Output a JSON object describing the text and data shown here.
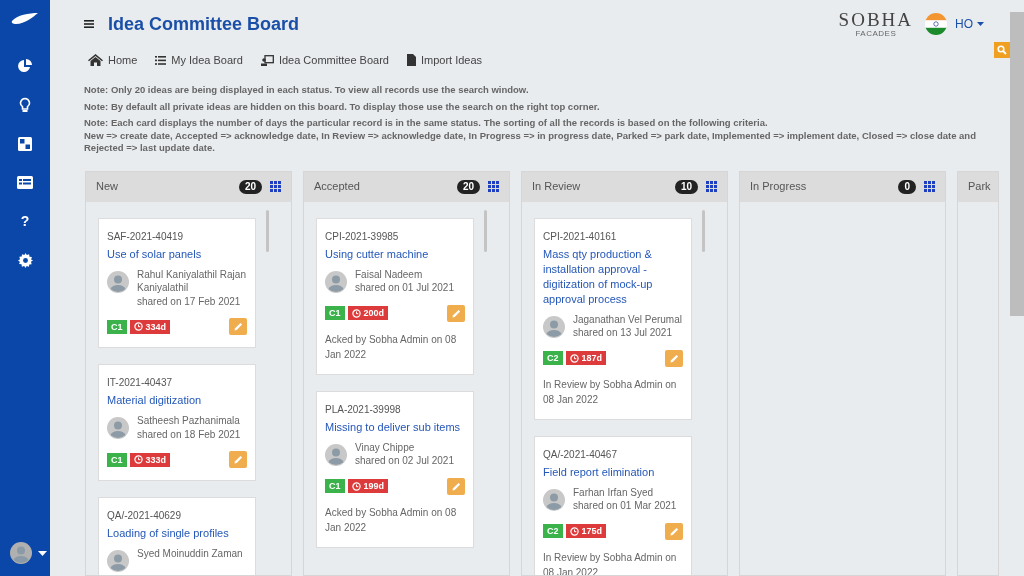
{
  "header": {
    "title": "Idea Committee Board",
    "brand": "SOBHA",
    "brand_sub": "FACADES",
    "user_location": "HO"
  },
  "nav": [
    {
      "label": "Home",
      "kind": "home"
    },
    {
      "label": "My Idea Board",
      "kind": "list"
    },
    {
      "label": "Idea Committee Board",
      "kind": "board"
    },
    {
      "label": "Import Ideas",
      "kind": "file"
    }
  ],
  "sidebar": {
    "items": [
      {
        "kind": "chart"
      },
      {
        "kind": "bulb"
      },
      {
        "kind": "grid"
      },
      {
        "kind": "table"
      },
      {
        "kind": "help",
        "label": "?"
      },
      {
        "kind": "settings"
      }
    ]
  },
  "notes": [
    "Note: Only 20 ideas are being displayed in each status. To view all records use the search window.",
    "Note: By default all private ideas are hidden on this board. To display those use the search on the right top corner.",
    "Note: Each card displays the number of days the particular record is in the same status. The sorting of all the records is based on the following criteria.\nNew => create date, Accepted => acknowledge date, In Review => acknowledge date, In Progress => in progress date, Parked => park date, Implemented => implement date, Closed => close date and Rejected => last update date."
  ],
  "columns": [
    {
      "title": "New",
      "count": "20",
      "cards": [
        {
          "id": "SAF-2021-40419",
          "title": "Use of solar panels",
          "author": "Rahul Kaniyalathil Rajan Kaniyalathil",
          "shared": "shared on 17 Feb 2021",
          "category": "C1",
          "days": "334d"
        },
        {
          "id": "IT-2021-40437",
          "title": "Material digitization",
          "author": "Satheesh Pazhanimala",
          "shared": "shared on 18 Feb 2021",
          "category": "C1",
          "days": "333d"
        },
        {
          "id": "QA/-2021-40629",
          "title": "Loading of single profiles",
          "author": "Syed Moinuddin Zaman"
        }
      ]
    },
    {
      "title": "Accepted",
      "count": "20",
      "cards": [
        {
          "id": "CPI-2021-39985",
          "title": "Using cutter machine",
          "author": "Faisal Nadeem",
          "shared": "shared on 01 Jul 2021",
          "category": "C1",
          "days": "200d",
          "footer": "Acked by Sobha Admin on 08 Jan 2022"
        },
        {
          "id": "PLA-2021-39998",
          "title": "Missing to deliver sub items",
          "author": "Vinay Chippe",
          "shared": "shared on 02 Jul 2021",
          "category": "C1",
          "days": "199d",
          "footer": "Acked by Sobha Admin on 08 Jan 2022"
        }
      ]
    },
    {
      "title": "In Review",
      "count": "10",
      "cards": [
        {
          "id": "CPI-2021-40161",
          "title": "Mass qty production & installation approval - digitization of mock-up approval process",
          "author": "Jaganathan Vel Perumal",
          "shared": "shared on 13 Jul 2021",
          "category": "C2",
          "days": "187d",
          "footer": "In Review by Sobha Admin on 08 Jan 2022"
        },
        {
          "id": "QA/-2021-40467",
          "title": "Field report elimination",
          "author": "Farhan Irfan Syed",
          "shared": "shared on 01 Mar 2021",
          "category": "C2",
          "days": "175d",
          "footer": "In Review by Sobha Admin on 08 Jan 2022"
        }
      ]
    },
    {
      "title": "In Progress",
      "count": "0"
    },
    {
      "title": "Park"
    }
  ]
}
